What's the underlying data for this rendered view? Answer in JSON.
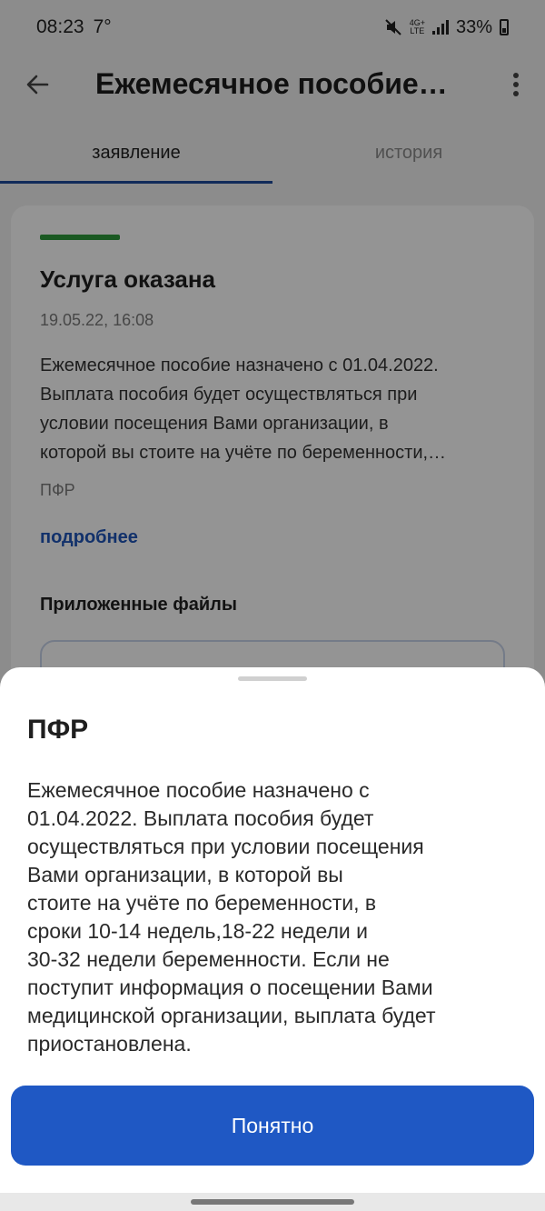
{
  "status_bar": {
    "time": "08:23",
    "temperature": "7°",
    "network_label_top": "4G+",
    "network_label_bottom": "LTE",
    "battery": "33%",
    "icons": [
      "mute-icon",
      "signal-icon",
      "battery-icon"
    ]
  },
  "app_bar": {
    "title": "Ежемесячное пособие…",
    "back_icon": "arrow-left-icon",
    "menu_icon": "more-vertical-icon"
  },
  "tabs": [
    {
      "label": "заявление",
      "active": true
    },
    {
      "label": "история",
      "active": false
    }
  ],
  "card": {
    "status_color": "#2e9a3b",
    "status_title": "Услуга оказана",
    "date": "19.05.22, 16:08",
    "description_lines": [
      "Ежемесячное пособие назначено с 01.04.2022.",
      "Выплата пособия будет осуществляться при",
      "условии посещения Вами организации, в",
      "которой вы стоите на учёте по беременности,…"
    ],
    "organization": "ПФР",
    "details_link": "подробнее",
    "files_label": "Приложенные файлы"
  },
  "sheet": {
    "title": "ПФР",
    "body_lines": [
      "Ежемесячное пособие назначено с",
      "01.04.2022. Выплата пособия будет",
      "осуществляться при условии посещения",
      "Вами организации, в которой вы",
      "стоите на учёте по беременности, в",
      "сроки 10-14 недель,18-22 недели и",
      "30-32 недели беременности. Если не",
      "поступит информация о посещении Вами",
      "медицинской организации, выплата будет",
      "приостановлена."
    ],
    "button_label": "Понятно"
  },
  "colors": {
    "accent": "#1f58c4",
    "link": "#1f55b8",
    "tab_indicator": "#1e4a9c"
  }
}
